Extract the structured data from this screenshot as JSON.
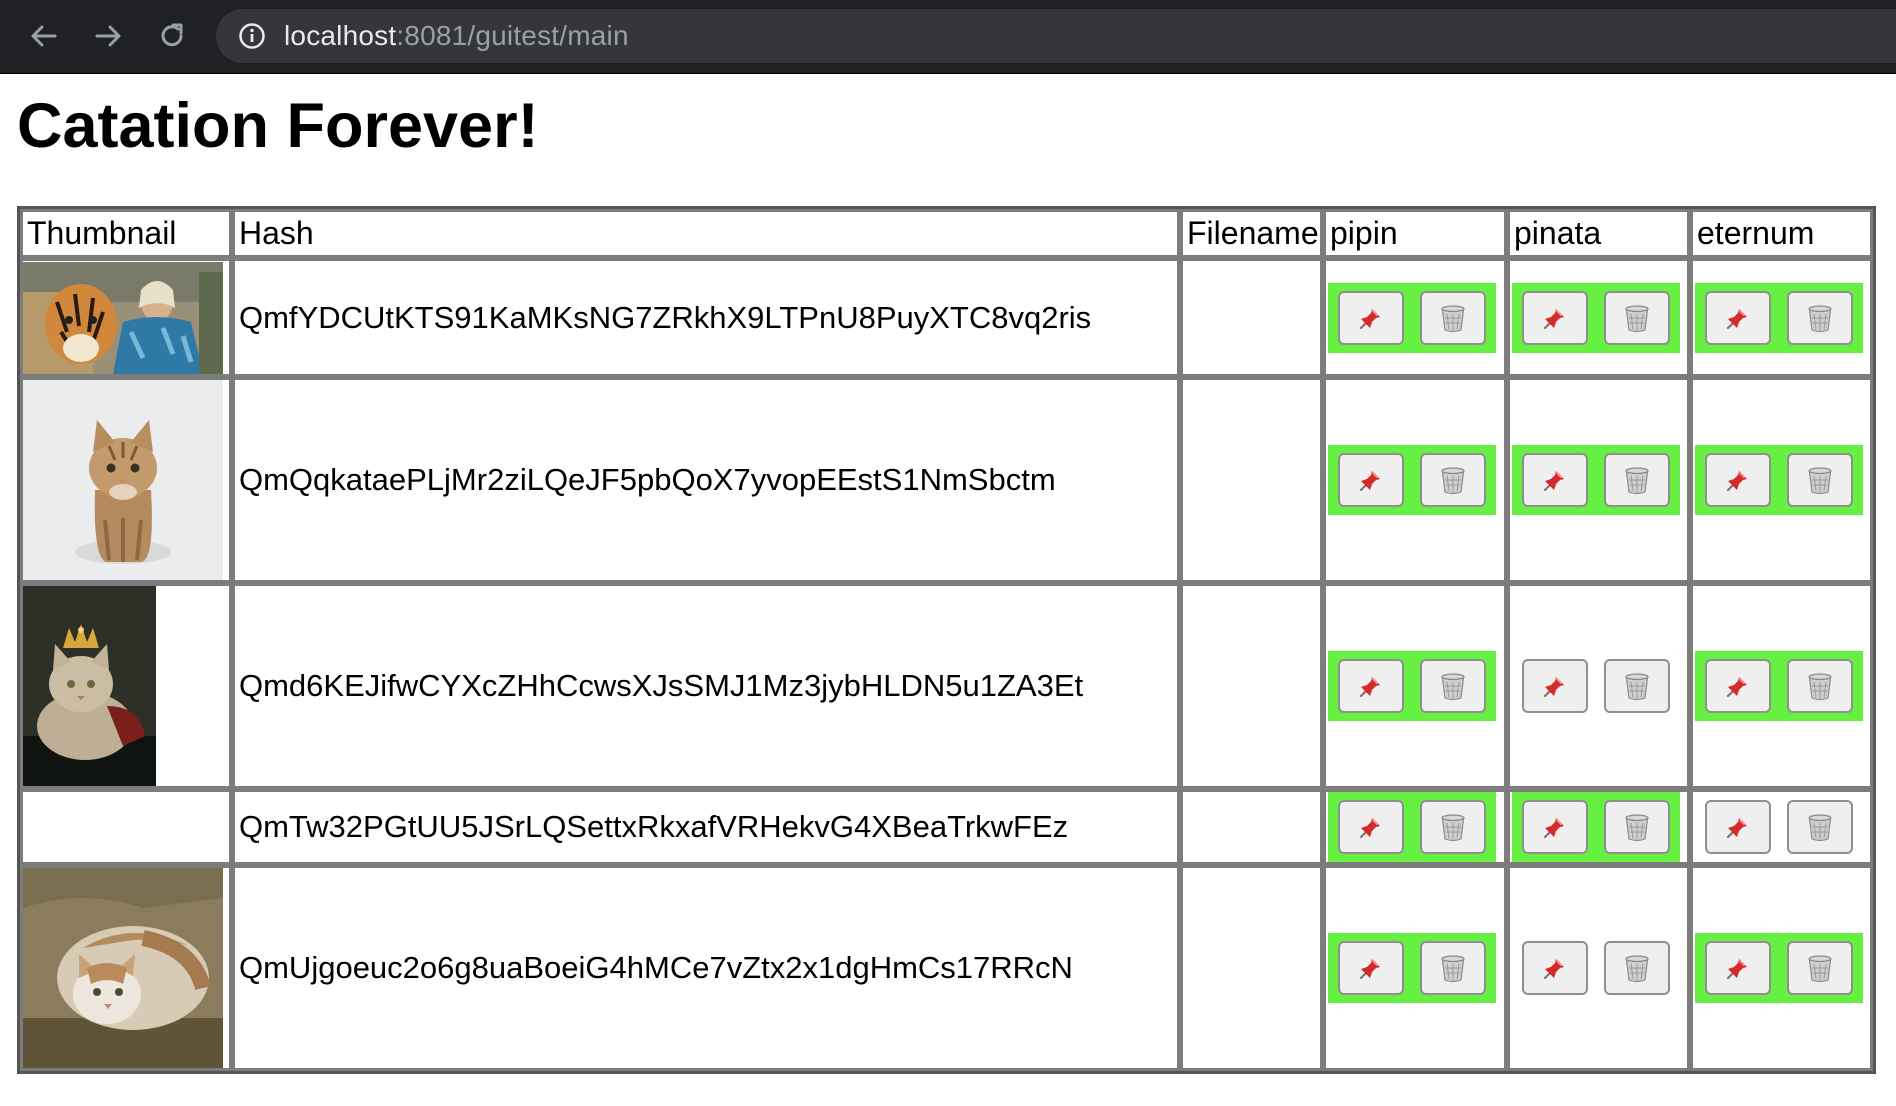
{
  "browser": {
    "url_host": "localhost",
    "url_rest": ":8081/guitest/main"
  },
  "page": {
    "title": "Catation Forever!"
  },
  "table": {
    "headers": [
      "Thumbnail",
      "Hash",
      "Filename",
      "pipin",
      "pinata",
      "eternum"
    ],
    "services": [
      "pipin",
      "pinata",
      "eternum"
    ],
    "rows": [
      {
        "thumbnail": "tiger-and-man",
        "hash": "QmfYDCUtKTS91KaMKsNG7ZRkhX9LTPnU8PuyXTC8vq2ris",
        "filename": "",
        "pinned": [
          true,
          true,
          true
        ]
      },
      {
        "thumbnail": "tabby-kitten-in-snow",
        "hash": "QmQqkataePLjMr2ziLQeJF5pbQoX7yvopEEstS1NmSbctm",
        "filename": "",
        "pinned": [
          true,
          true,
          true
        ]
      },
      {
        "thumbnail": "cat-with-crown",
        "hash": "Qmd6KEJifwCYXcZHhCcwsXJsSMJ1Mz3jybHLDN5u1ZA3Et",
        "filename": "",
        "pinned": [
          true,
          false,
          true
        ]
      },
      {
        "thumbnail": "",
        "hash": "QmTw32PGtUU5JSrLQSettxRkxafVRHekvG4XBeaTrkwFEz",
        "filename": "",
        "pinned": [
          true,
          true,
          false
        ]
      },
      {
        "thumbnail": "fluffy-cat-on-ground",
        "hash": "QmUjgoeuc2o6g8uaBoeiG4hMCe7vZtx2x1dgHmCs17RRcN",
        "filename": "",
        "pinned": [
          true,
          false,
          true
        ]
      }
    ]
  },
  "icons": {
    "pin": "pushpin-icon",
    "delete": "wastebasket-icon"
  },
  "colors": {
    "pinned_highlight": "#66f042",
    "chrome_bg": "#202124"
  }
}
